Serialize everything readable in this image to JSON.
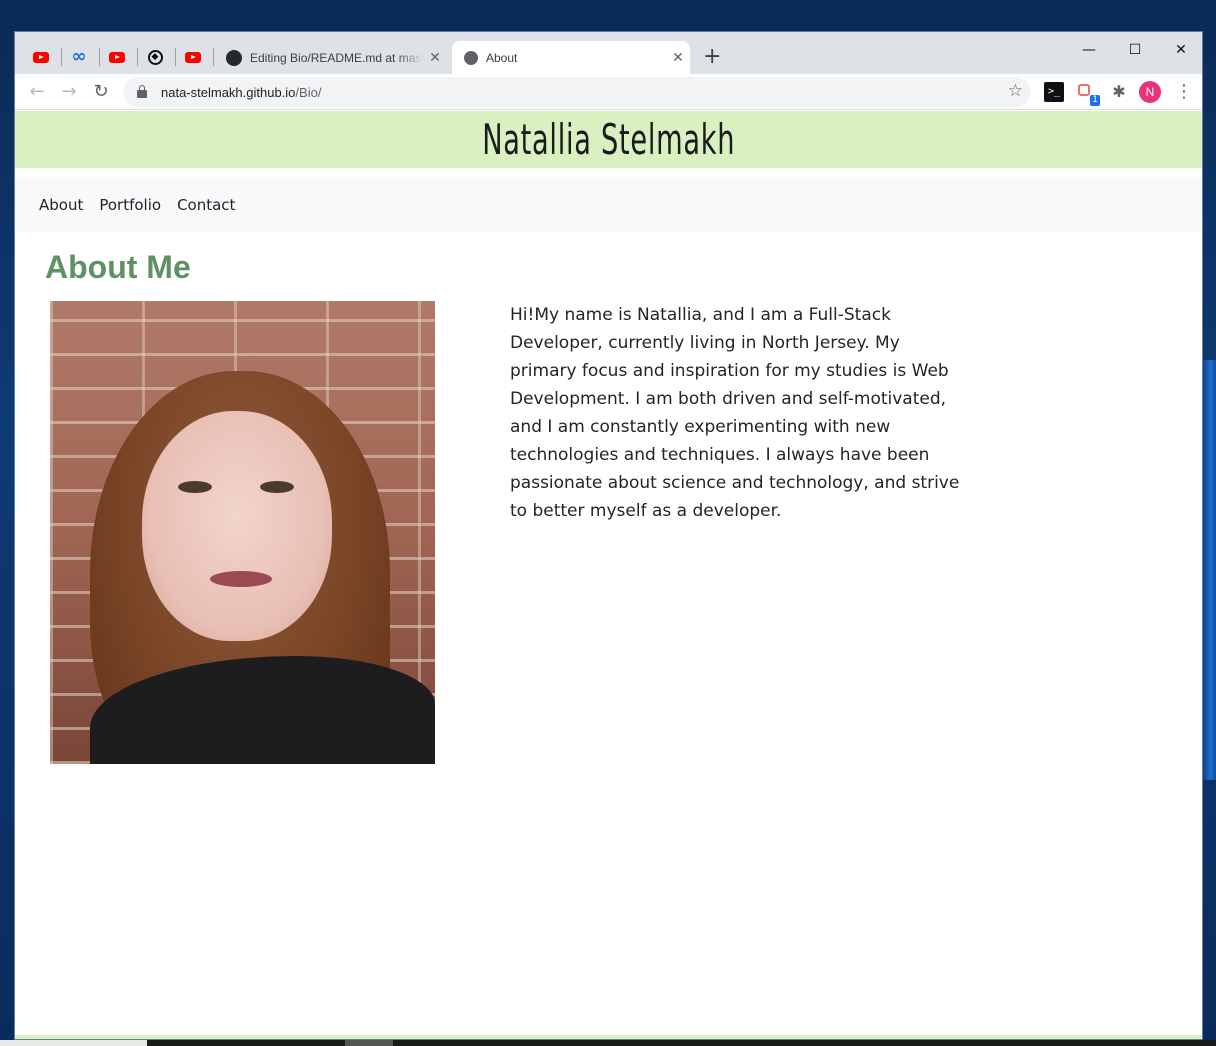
{
  "browser": {
    "tabs": [
      {
        "title": "Editing Bio/README.md at maste",
        "icon": "github-icon"
      },
      {
        "title": "About",
        "icon": "globe-icon"
      }
    ],
    "pinned_tabs": [
      "youtube-icon",
      "infinity-icon",
      "youtube-icon",
      "codepen-icon",
      "youtube-icon"
    ],
    "address": {
      "host": "nata-stelmakh.github.io",
      "path": "/Bio/"
    },
    "extension_badge": "1",
    "profile_initial": "N",
    "profile_color": "#e8337a"
  },
  "site": {
    "title": "Natallia Stelmakh",
    "nav": [
      "About",
      "Portfolio",
      "Contact"
    ],
    "heading": "About Me",
    "bio": "Hi!My name is Natallia, and I am a Full-Stack Developer, currently living in North Jersey. My primary focus and inspiration for my studies is Web Development. I am both driven and self-motivated, and I am constantly experimenting with new technologies and techniques. I always have been passionate about science and technology, and strive to better myself as a developer.",
    "colors": {
      "header_bg": "#d9f0c0",
      "heading": "#5e9163",
      "nav_bg": "#f8f9fa"
    }
  }
}
